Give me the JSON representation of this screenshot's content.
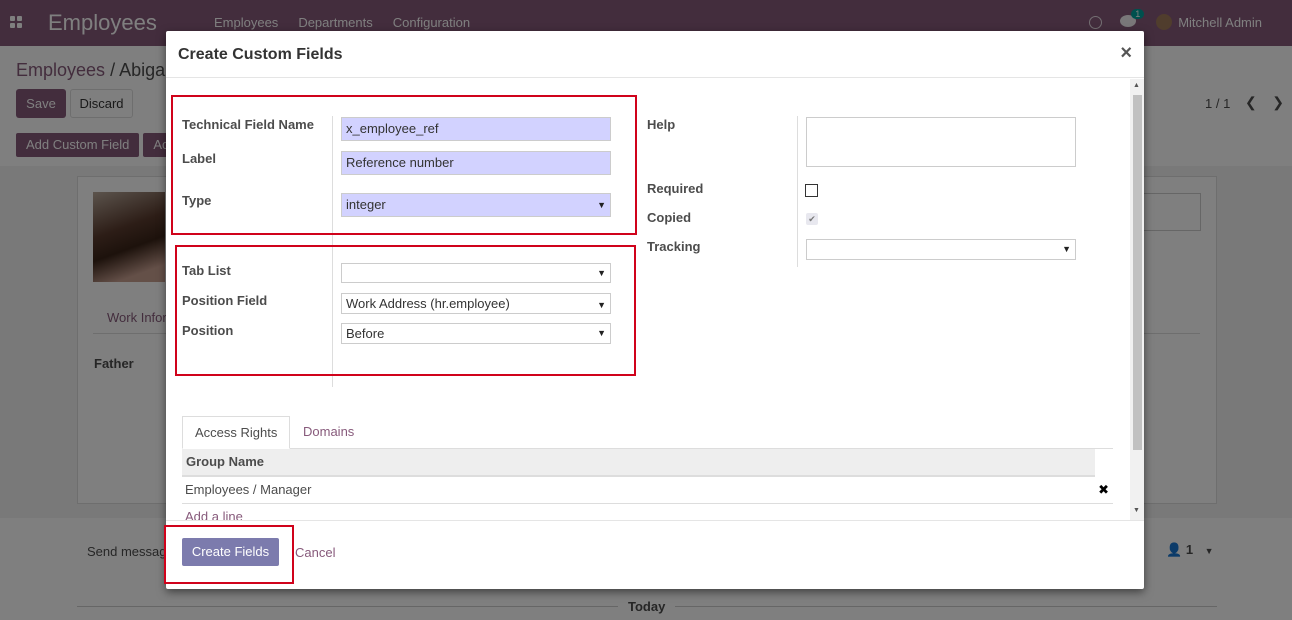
{
  "app": {
    "name": "Employees",
    "menu": [
      "Employees",
      "Departments",
      "Configuration"
    ],
    "chat_count": "1",
    "user_name": "Mitchell Admin"
  },
  "background": {
    "breadcrumb_root": "Employees",
    "breadcrumb_sep": "/",
    "breadcrumb_current": "Abiga",
    "save_label": "Save",
    "discard_label": "Discard",
    "pager": "1 / 1",
    "add_custom_field_label": "Add Custom Field",
    "second_button_label": "Ac",
    "tab_label": "Work Infor",
    "father_label": "Father",
    "send_message_label": "Send messag",
    "followers_count": "1",
    "today_label": "Today"
  },
  "modal": {
    "title": "Create Custom Fields",
    "close_symbol": "×",
    "technical_field_name_label": "Technical Field Name",
    "technical_field_name_value": "x_employee_ref",
    "label_label": "Label",
    "label_value": "Reference number",
    "type_label": "Type",
    "type_value": "integer",
    "tab_list_label": "Tab List",
    "tab_list_value": "",
    "position_field_label": "Position Field",
    "position_field_value": "Work Address (hr.employee)",
    "position_label": "Position",
    "position_value": "Before",
    "help_label": "Help",
    "help_value": "",
    "required_label": "Required",
    "required_checked": false,
    "copied_label": "Copied",
    "copied_checked": true,
    "tracking_label": "Tracking",
    "tracking_value": "",
    "tabs": [
      "Access Rights",
      "Domains"
    ],
    "table_header": "Group Name",
    "table_rows": [
      "Employees / Manager"
    ],
    "add_line_label": "Add a line",
    "create_button_label": "Create Fields",
    "cancel_button_label": "Cancel"
  },
  "colors": {
    "brand": "#875a7b",
    "highlight_border": "#d0021b",
    "required_field_bg": "#d2d2ff",
    "primary_button": "#7c7bad"
  }
}
